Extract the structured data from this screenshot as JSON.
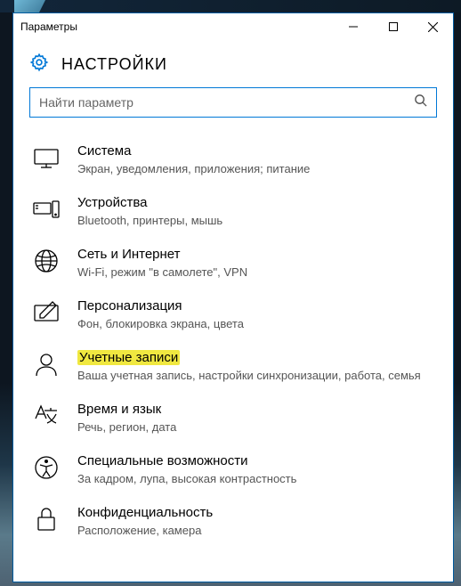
{
  "titlebar": {
    "title": "Параметры"
  },
  "header": {
    "heading": "НАСТРОЙКИ"
  },
  "search": {
    "placeholder": "Найти параметр"
  },
  "items": [
    {
      "title": "Система",
      "desc": "Экран, уведомления, приложения; питание"
    },
    {
      "title": "Устройства",
      "desc": "Bluetooth, принтеры, мышь"
    },
    {
      "title": "Сеть и Интернет",
      "desc": "Wi-Fi, режим \"в самолете\", VPN"
    },
    {
      "title": "Персонализация",
      "desc": "Фон, блокировка экрана, цвета"
    },
    {
      "title": "Учетные записи",
      "desc": "Ваша учетная запись, настройки синхронизации, работа, семья",
      "highlight": true
    },
    {
      "title": "Время и язык",
      "desc": "Речь, регион, дата"
    },
    {
      "title": "Специальные возможности",
      "desc": "За кадром, лупа, высокая контрастность"
    },
    {
      "title": "Конфиденциальность",
      "desc": "Расположение, камера"
    }
  ],
  "colors": {
    "accent": "#0078d7",
    "highlight": "#f0e840"
  }
}
